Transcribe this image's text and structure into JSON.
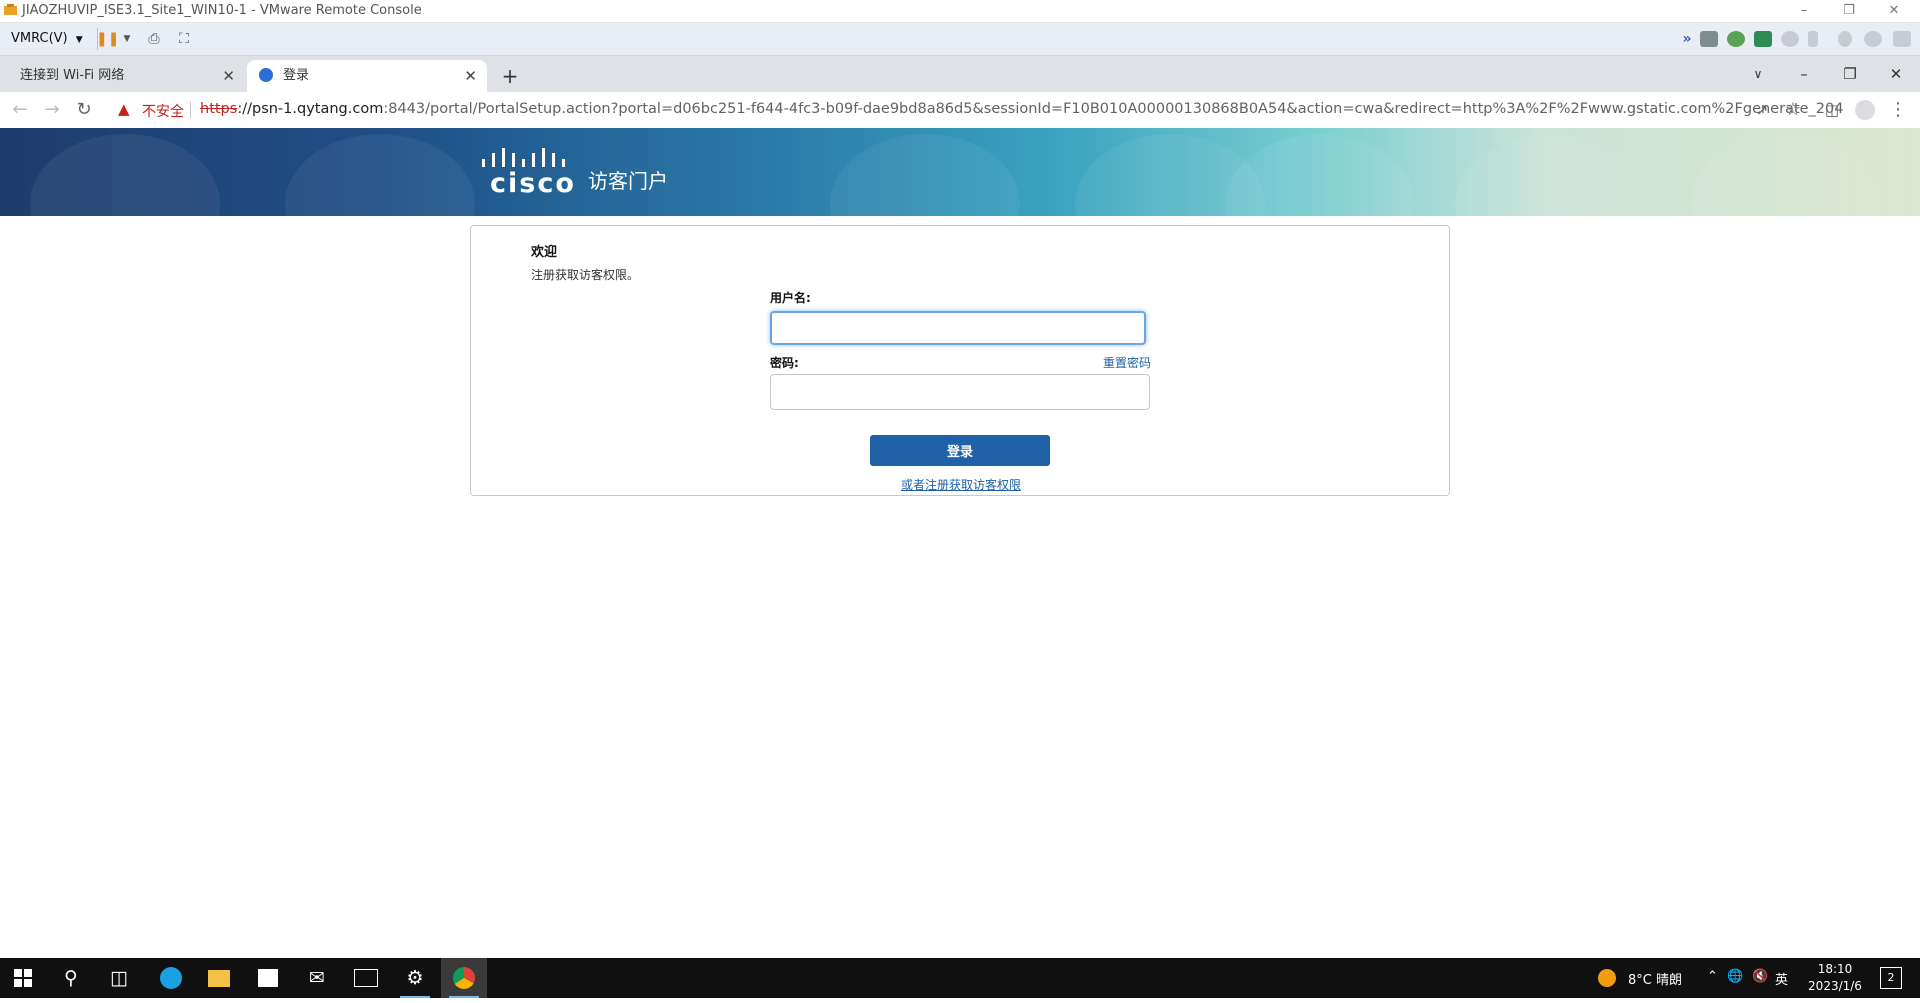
{
  "vmrc": {
    "window_title": "JIAOZHUVIP_ISE3.1_Site1_WIN10-1 - VMware Remote Console",
    "menu_label": "VMRC(V)"
  },
  "browser": {
    "tabs": [
      {
        "label": "连接到 Wi-Fi 网络",
        "active": false
      },
      {
        "label": "登录",
        "active": true
      }
    ],
    "security_label": "不安全",
    "url_scheme": "https",
    "url_host": "://psn-1.qytang.com",
    "url_rest": ":8443/portal/PortalSetup.action?portal=d06bc251-f644-4fc3-b09f-dae9bd8a86d5&sessionId=F10B010A00000130868B0A54&action=cwa&redirect=http%3A%2F%2Fwww.gstatic.com%2Fgenerate_204"
  },
  "banner": {
    "logo_text": "cisco",
    "title": "访客门户"
  },
  "login": {
    "welcome": "欢迎",
    "subtitle": "注册获取访客权限。",
    "username_label": "用户名:",
    "username_value": "",
    "password_label": "密码:",
    "reset_password_link": "重置密码",
    "login_button": "登录",
    "register_link": "或者注册获取访客权限"
  },
  "taskbar": {
    "weather": "8°C  晴朗",
    "ime": "英",
    "time": "18:10",
    "date": "2023/1/6",
    "notifications": "2"
  },
  "colors": {
    "accent": "#1f62a8",
    "link": "#1f5fa5",
    "warning": "#c5221f"
  }
}
